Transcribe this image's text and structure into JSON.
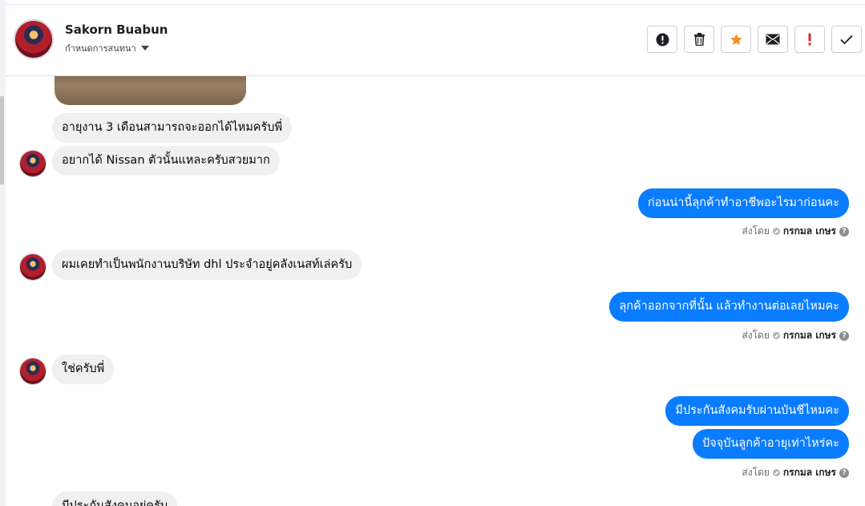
{
  "header": {
    "name": "Sakorn Buabun",
    "subtitle": "กำหนดการสนทนา"
  },
  "toolbar": {
    "icons": [
      "exclamation-circle-icon",
      "trash-icon",
      "star-icon",
      "envelope-icon",
      "exclamation-icon",
      "check-icon"
    ],
    "colors": {
      "star": "#f4901e",
      "alert": "#e4212a"
    }
  },
  "messages": {
    "m1": "อายุงาน 3 เดือนสามารถจะออกได้ไหมครับพี่",
    "m2": "อยากได้ Nissan ตัวนั้นแหละครับสวยมาก",
    "m3": "ก่อนน่านี้ลุกค้าทำอาชีพอะไรมาก่อนคะ",
    "m4": "ผมเคยทำเป็นพนักงานบริษัท dhl ประจำอยู่คลังเนสท์เล่ครับ",
    "m5": "ลุกค้าออกจากที่นั้น แล้วทำงานต่อเลยไหมคะ",
    "m6": "ใช่ครับพี่",
    "m7": "มีประกันสังคมรับผ่านบันชีไหมคะ",
    "m8": "ปัจจุบันลูกค้าอายุเท่าไหร่คะ",
    "m9": "มีประกันสังคมอยู่ครับ"
  },
  "sent_by": {
    "prefix": "ส่งโดย",
    "agent": "กรกมล เกษร"
  },
  "colors": {
    "outgoing": "#0a7cff",
    "incoming": "#f0f0f0"
  }
}
